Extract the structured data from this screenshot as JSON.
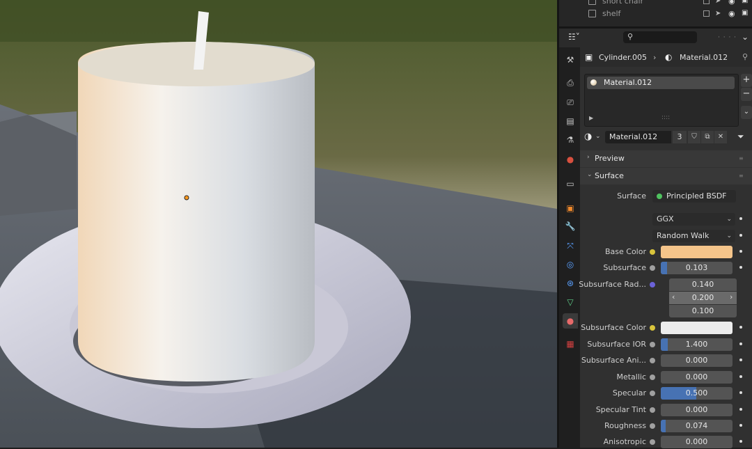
{
  "colors": {
    "accent": "#4772b3",
    "base_color_swatch": "#f4c48a",
    "subsurface_color_swatch": "#ececec",
    "socket_yellow": "#d8c43c",
    "socket_gray": "#a0a0a0",
    "socket_purple": "#6b62d8",
    "socket_green": "#4fc25f"
  },
  "outliner": {
    "rows": [
      {
        "label": "short chair",
        "icon": "object-icon"
      },
      {
        "label": "shelf",
        "icon": "object-icon"
      }
    ]
  },
  "header": {
    "editor_type_icon": "properties-editor-icon",
    "search_placeholder": ""
  },
  "breadcrumb": {
    "object": "Cylinder.005",
    "separator": "›",
    "material": "Material.012"
  },
  "material_slots": [
    {
      "name": "Material.012",
      "selected": true
    }
  ],
  "material_selector": {
    "name": "Material.012",
    "users": "3"
  },
  "panels": {
    "preview": "Preview",
    "surface": "Surface"
  },
  "surface": {
    "shader_label": "Surface",
    "shader_value": "Principled BSDF",
    "distribution": "GGX",
    "subsurface_method": "Random Walk"
  },
  "properties": [
    {
      "label": "Base Color",
      "type": "color",
      "socket": "yellow"
    },
    {
      "label": "Subsurface",
      "value": "0.103",
      "fraction": 0.103,
      "socket": "gray"
    },
    {
      "label": "Subsurface Rad...",
      "type": "vector",
      "values": [
        "0.140",
        "0.200",
        "0.100"
      ],
      "socket": "purple"
    },
    {
      "label": "Subsurface Color",
      "type": "color",
      "socket": "yellow"
    },
    {
      "label": "Subsurface IOR",
      "value": "1.400",
      "fraction": 0.1,
      "socket": "gray"
    },
    {
      "label": "Subsurface Ani...",
      "value": "0.000",
      "fraction": 0,
      "socket": "gray"
    },
    {
      "label": "Metallic",
      "value": "0.000",
      "fraction": 0,
      "socket": "gray"
    },
    {
      "label": "Specular",
      "value": "0.500",
      "fraction": 0.5,
      "socket": "gray"
    },
    {
      "label": "Specular Tint",
      "value": "0.000",
      "fraction": 0,
      "socket": "gray"
    },
    {
      "label": "Roughness",
      "value": "0.074",
      "fraction": 0.074,
      "socket": "gray"
    },
    {
      "label": "Anisotropic",
      "value": "0.000",
      "fraction": 0,
      "socket": "gray"
    }
  ]
}
